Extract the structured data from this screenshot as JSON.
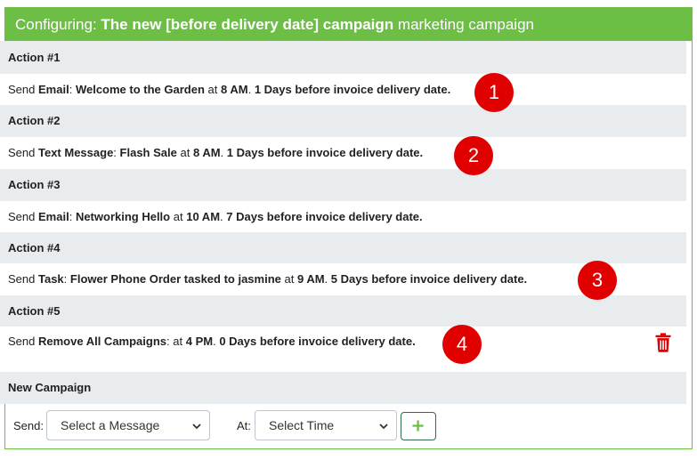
{
  "header": {
    "prefix": "Configuring:",
    "campaign_name": "The new [before delivery date] campaign",
    "suffix": "marketing campaign"
  },
  "actions": [
    {
      "title": "Action #1",
      "verb": "Send",
      "type": "Email",
      "sep": ":",
      "name": "Welcome to the Garden",
      "at": "at",
      "time": "8 AM",
      "when": "1 Days before invoice delivery date."
    },
    {
      "title": "Action #2",
      "verb": "Send",
      "type": "Text Message",
      "sep": ":",
      "name": "Flash Sale",
      "at": "at",
      "time": "8 AM",
      "when": "1 Days before invoice delivery date."
    },
    {
      "title": "Action #3",
      "verb": "Send",
      "type": "Email",
      "sep": ":",
      "name": "Networking Hello",
      "at": "at",
      "time": "10 AM",
      "when": "7 Days before invoice delivery date."
    },
    {
      "title": "Action #4",
      "verb": "Send",
      "type": "Task",
      "sep": ":",
      "name": "Flower Phone Order tasked to jasmine",
      "at": "at",
      "time": "9 AM",
      "when": "5 Days before invoice delivery date."
    },
    {
      "title": "Action #5",
      "verb": "Send",
      "type": "Remove All Campaigns",
      "sep": ":",
      "name": "",
      "at": "at",
      "time": "4 PM",
      "when": "0 Days before invoice delivery date."
    }
  ],
  "annotations": [
    "1",
    "2",
    "3",
    "4"
  ],
  "new_campaign": {
    "title": "New Campaign",
    "send_label": "Send:",
    "message_select": "Select a Message",
    "at_label": "At:",
    "time_select": "Select Time"
  },
  "colors": {
    "header_green": "#6cbe45",
    "row_gray": "#e9ecee",
    "badge_red": "#e00000",
    "trash_red": "#e00000",
    "add_green": "#6cbe45"
  },
  "icons": {
    "delete": "trash-icon",
    "add": "plus-icon",
    "select": "chevron-down-icon"
  }
}
